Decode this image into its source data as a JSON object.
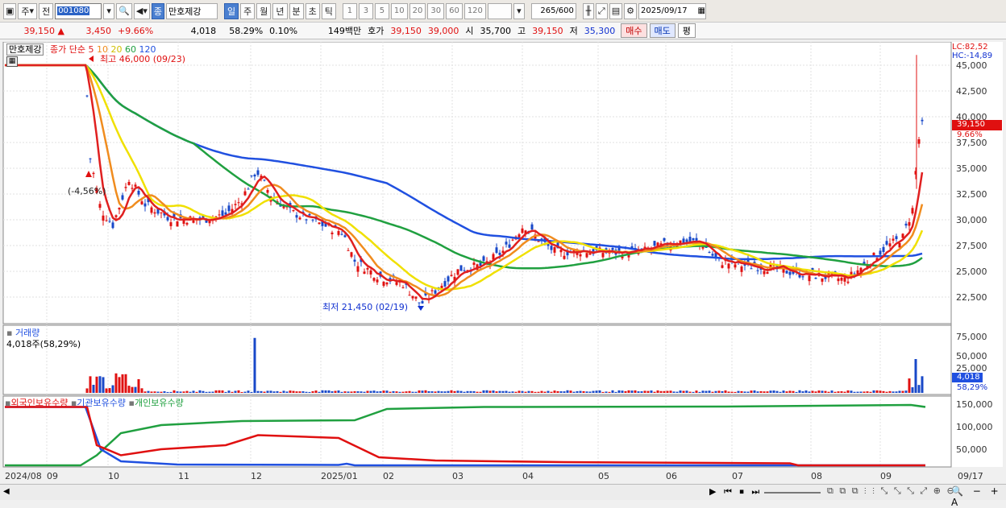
{
  "toolbar": {
    "period_label": "주",
    "prev_label": "전",
    "stock_code": "001080",
    "stock_name": "만호제강",
    "type_badge": "종",
    "period_tabs": [
      "일",
      "주",
      "월",
      "년",
      "분",
      "초",
      "틱"
    ],
    "active_tab": "일",
    "intervals": [
      "1",
      "3",
      "5",
      "10",
      "20",
      "30",
      "60",
      "120"
    ],
    "count": "265",
    "count_total": "/600",
    "date": "2025/09/17"
  },
  "pricebar": {
    "price": "39,150",
    "change": "3,450",
    "change_pct": "+9.66%",
    "volume": "4,018",
    "volume_pct": "58.29%",
    "turnover_pct": "0.10%",
    "amount": "149백만",
    "bid_label": "호가",
    "bid": "39,150",
    "ask": "39,000",
    "open_label": "시",
    "open": "35,700",
    "high_label": "고",
    "high": "39,150",
    "low_label": "저",
    "low": "35,300",
    "buy_label": "매수",
    "sell_label": "매도",
    "avg_label": "평"
  },
  "price_panel": {
    "name_tag": "만호제강",
    "legend_prefix": "종가 단순",
    "ma_labels": [
      "5",
      "10",
      "20",
      "60",
      "120"
    ],
    "ma_colors": [
      "#e02020",
      "#f08c1e",
      "#f0e000",
      "#20a040",
      "#2050e0"
    ],
    "high_note": "최고 46,000 (09/23)",
    "low_note": "최저 21,450 (02/19)",
    "left_note": "(-4,56%)",
    "lc": "LC:82,52",
    "hc": "HC:-14,89",
    "current_price": "39,150",
    "current_pct": "9.66%",
    "y_ticks": [
      "45,000",
      "42,500",
      "40,000",
      "37,500",
      "35,000",
      "32,500",
      "30,000",
      "27,500",
      "25,000",
      "22,500"
    ]
  },
  "volume_panel": {
    "title": "거래량",
    "value_note": "4,018주(58,29%)",
    "y_ticks": [
      "75,000",
      "50,000",
      "25,000"
    ],
    "current": "4,018",
    "current_pct": "58,29%"
  },
  "holding_panel": {
    "legend": [
      "외국인보유수량",
      "기관보유수량",
      "개인보유수량"
    ],
    "colors": [
      "#e01010",
      "#2050e0",
      "#20a040"
    ],
    "y_ticks": [
      "150,000",
      "100,000",
      "50,000"
    ]
  },
  "x_axis": {
    "labels": [
      "2024/08",
      "09",
      "10",
      "11",
      "12",
      "2025/01",
      "02",
      "03",
      "04",
      "05",
      "06",
      "07",
      "08",
      "09"
    ],
    "end_label": "09/17"
  }
}
